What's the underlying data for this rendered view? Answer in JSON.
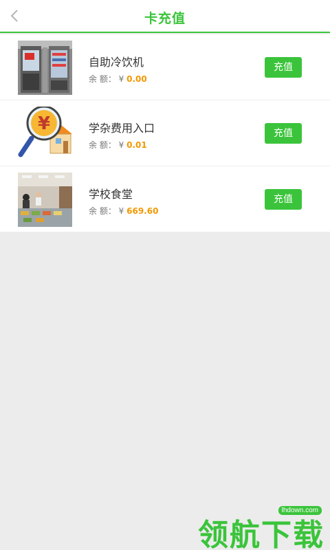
{
  "header": {
    "title": "卡充值",
    "back_icon": "chevron-left-icon"
  },
  "items": [
    {
      "name": "自助冷饮机",
      "balance_label": "余 额：",
      "currency": "¥",
      "balance": "0.00",
      "button": "充值",
      "image": "vending-machine-photo"
    },
    {
      "name": "学杂费用入口",
      "balance_label": "余 额：",
      "currency": "¥",
      "balance": "0.01",
      "button": "充值",
      "image": "yuan-magnifier-house-illustration"
    },
    {
      "name": "学校食堂",
      "balance_label": "余 额：",
      "currency": "¥",
      "balance": "669.60",
      "button": "充值",
      "image": "canteen-photo"
    }
  ],
  "watermark": {
    "text": "领航下载",
    "url": "lhdown.com"
  },
  "colors": {
    "accent": "#3bc43b",
    "balance": "#f39800",
    "background": "#ececec"
  }
}
